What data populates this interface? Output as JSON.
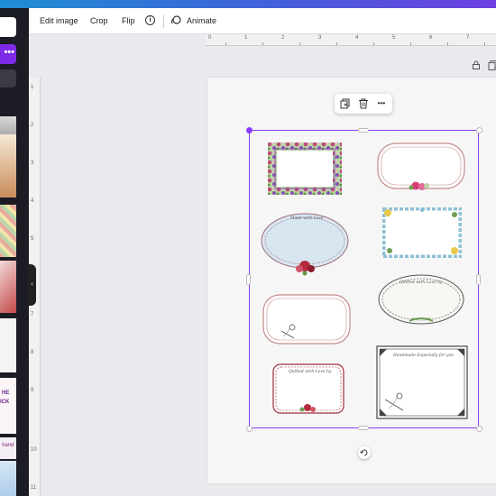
{
  "toolbar": {
    "edit_image": "Edit image",
    "crop": "Crop",
    "flip": "Flip",
    "info_glyph": "i",
    "animate": "Animate"
  },
  "left_panel": {
    "more_glyph": "•••",
    "collapse_glyph": "‹",
    "thumb_texts": [
      "HE",
      "ICK",
      "hand"
    ]
  },
  "rulers": {
    "horizontal": [
      "0",
      "1",
      "2",
      "3",
      "4",
      "5",
      "6",
      "7"
    ],
    "vertical": [
      "1",
      "2",
      "3",
      "4",
      "5",
      "6",
      "7",
      "8",
      "9",
      "10",
      "11"
    ]
  },
  "float_toolbar": {
    "more_glyph": "•••"
  },
  "labels": {
    "made_with_love": "Made with Love",
    "quilted_with_love_by": "Quilted with Love by",
    "quilted_with_love_by_2": "Quilted with Love by",
    "handmade": "Handmade Especially for you"
  },
  "colors": {
    "accent": "#8b3dff",
    "brand_button": "#7d2ae8",
    "panel_bg": "#1b1c24",
    "canvas_bg": "#e9eaee"
  },
  "icons": [
    "info-icon",
    "animate-icon",
    "lock-icon",
    "copy-icon",
    "duplicate-icon",
    "trash-icon",
    "more-icon",
    "rotate-icon",
    "collapse-icon"
  ]
}
